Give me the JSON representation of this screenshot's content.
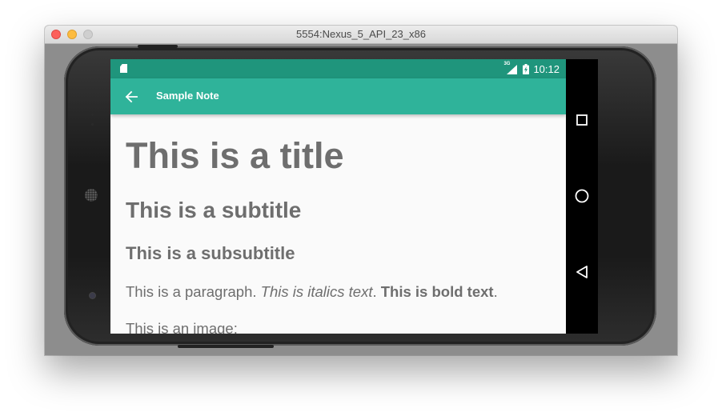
{
  "window": {
    "title": "5554:Nexus_5_API_23_x86"
  },
  "statusbar": {
    "network_type": "3G",
    "time": "10:12"
  },
  "appbar": {
    "title": "Sample Note"
  },
  "note": {
    "title": "This is a title",
    "subtitle": "This is a subtitle",
    "subsubtitle": "This is a subsubtitle",
    "paragraph": {
      "plain": "This is a paragraph. ",
      "italic": "This is italics text",
      "sep": ". ",
      "bold": "This is bold text",
      "end": "."
    },
    "image_caption": "This is an image:"
  },
  "icons": {
    "back": "arrow-left-icon",
    "sd_card": "sd-card-icon",
    "signal": "signal-icon",
    "battery": "battery-charging-icon",
    "recents": "square-icon",
    "home": "circle-icon",
    "back_nav": "triangle-back-icon"
  },
  "colors": {
    "statusbar": "#1f957c",
    "appbar": "#2fb39a",
    "text": "#6e6e6e",
    "background": "#fafafa"
  }
}
